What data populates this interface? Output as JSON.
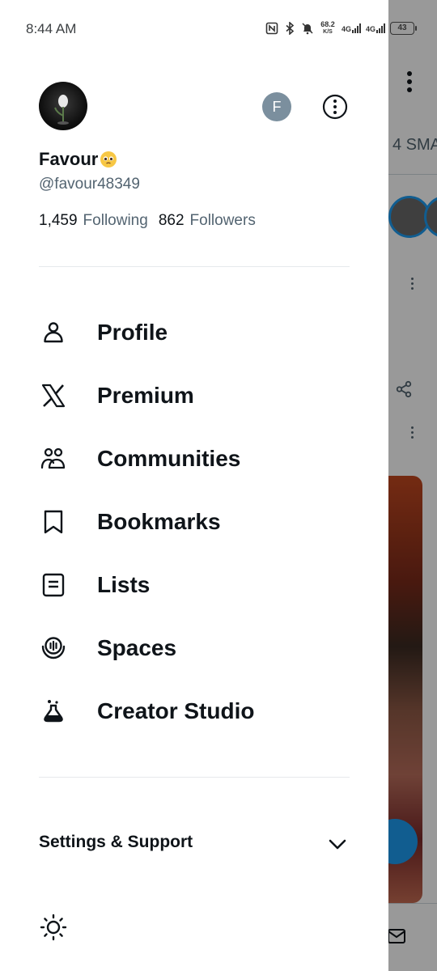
{
  "status_bar": {
    "time": "8:44 AM",
    "net_speed_value": "68.2",
    "net_speed_unit": "K/S",
    "sim1": "4G",
    "sim2": "4G",
    "battery": "43"
  },
  "profile": {
    "display_name": "Favour",
    "handle": "@favour48349",
    "following_count": "1,459",
    "following_label": "Following",
    "followers_count": "862",
    "followers_label": "Followers",
    "account_switch_initial": "F"
  },
  "menu": [
    {
      "label": "Profile",
      "icon": "person-icon"
    },
    {
      "label": "Premium",
      "icon": "x-logo-icon"
    },
    {
      "label": "Communities",
      "icon": "communities-icon"
    },
    {
      "label": "Bookmarks",
      "icon": "bookmark-icon"
    },
    {
      "label": "Lists",
      "icon": "list-icon"
    },
    {
      "label": "Spaces",
      "icon": "spaces-icon"
    },
    {
      "label": "Creator Studio",
      "icon": "flask-icon"
    }
  ],
  "settings": {
    "label": "Settings & Support"
  },
  "background": {
    "tab_fragment": "4 SMA"
  },
  "colors": {
    "text_primary": "#0f1419",
    "text_secondary": "#536471",
    "accent": "#1d9bf0",
    "badge": "#7b8f9e"
  }
}
